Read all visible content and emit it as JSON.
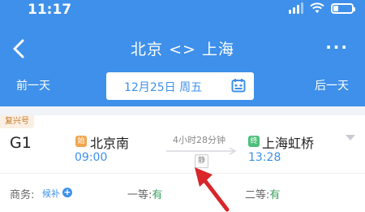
{
  "status_bar": {
    "time": "11:17"
  },
  "nav": {
    "route": "北京 <> 上海",
    "more": "···"
  },
  "date_bar": {
    "prev_label": "前一天",
    "date": "12月25日 周五",
    "next_label": "后一天"
  },
  "train": {
    "type_tag": "复兴号",
    "number": "G1",
    "start_badge": "始",
    "end_badge": "终",
    "departure_station": "北京南",
    "departure_time": "09:00",
    "duration": "4小时28分钟",
    "quiet_tag": "静",
    "arrival_station": "上海虹桥",
    "arrival_time": "13:28",
    "seats": {
      "business_label": "商务:",
      "business_value": "候补",
      "business_plus": "+",
      "first_label": "一等:",
      "first_value": "有",
      "second_label": "二等:",
      "second_value": "有"
    }
  },
  "colors": {
    "brand_blue": "#3e90ea",
    "available_green": "#3aa15c",
    "annotation_red": "#d8262b"
  },
  "icons": [
    "back-arrow-icon",
    "more-icon",
    "calendar-icon",
    "signal-icon",
    "wifi-icon",
    "battery-icon",
    "chevron-down-icon",
    "annotation-arrow"
  ]
}
